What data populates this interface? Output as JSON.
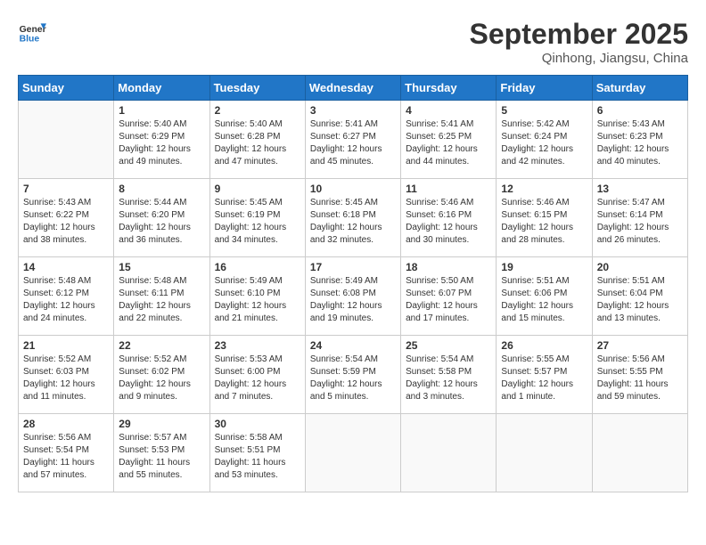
{
  "header": {
    "logo_line1": "General",
    "logo_line2": "Blue",
    "month": "September 2025",
    "location": "Qinhong, Jiangsu, China"
  },
  "days_of_week": [
    "Sunday",
    "Monday",
    "Tuesday",
    "Wednesday",
    "Thursday",
    "Friday",
    "Saturday"
  ],
  "weeks": [
    [
      {
        "day": "",
        "info": ""
      },
      {
        "day": "1",
        "info": "Sunrise: 5:40 AM\nSunset: 6:29 PM\nDaylight: 12 hours\nand 49 minutes."
      },
      {
        "day": "2",
        "info": "Sunrise: 5:40 AM\nSunset: 6:28 PM\nDaylight: 12 hours\nand 47 minutes."
      },
      {
        "day": "3",
        "info": "Sunrise: 5:41 AM\nSunset: 6:27 PM\nDaylight: 12 hours\nand 45 minutes."
      },
      {
        "day": "4",
        "info": "Sunrise: 5:41 AM\nSunset: 6:25 PM\nDaylight: 12 hours\nand 44 minutes."
      },
      {
        "day": "5",
        "info": "Sunrise: 5:42 AM\nSunset: 6:24 PM\nDaylight: 12 hours\nand 42 minutes."
      },
      {
        "day": "6",
        "info": "Sunrise: 5:43 AM\nSunset: 6:23 PM\nDaylight: 12 hours\nand 40 minutes."
      }
    ],
    [
      {
        "day": "7",
        "info": "Sunrise: 5:43 AM\nSunset: 6:22 PM\nDaylight: 12 hours\nand 38 minutes."
      },
      {
        "day": "8",
        "info": "Sunrise: 5:44 AM\nSunset: 6:20 PM\nDaylight: 12 hours\nand 36 minutes."
      },
      {
        "day": "9",
        "info": "Sunrise: 5:45 AM\nSunset: 6:19 PM\nDaylight: 12 hours\nand 34 minutes."
      },
      {
        "day": "10",
        "info": "Sunrise: 5:45 AM\nSunset: 6:18 PM\nDaylight: 12 hours\nand 32 minutes."
      },
      {
        "day": "11",
        "info": "Sunrise: 5:46 AM\nSunset: 6:16 PM\nDaylight: 12 hours\nand 30 minutes."
      },
      {
        "day": "12",
        "info": "Sunrise: 5:46 AM\nSunset: 6:15 PM\nDaylight: 12 hours\nand 28 minutes."
      },
      {
        "day": "13",
        "info": "Sunrise: 5:47 AM\nSunset: 6:14 PM\nDaylight: 12 hours\nand 26 minutes."
      }
    ],
    [
      {
        "day": "14",
        "info": "Sunrise: 5:48 AM\nSunset: 6:12 PM\nDaylight: 12 hours\nand 24 minutes."
      },
      {
        "day": "15",
        "info": "Sunrise: 5:48 AM\nSunset: 6:11 PM\nDaylight: 12 hours\nand 22 minutes."
      },
      {
        "day": "16",
        "info": "Sunrise: 5:49 AM\nSunset: 6:10 PM\nDaylight: 12 hours\nand 21 minutes."
      },
      {
        "day": "17",
        "info": "Sunrise: 5:49 AM\nSunset: 6:08 PM\nDaylight: 12 hours\nand 19 minutes."
      },
      {
        "day": "18",
        "info": "Sunrise: 5:50 AM\nSunset: 6:07 PM\nDaylight: 12 hours\nand 17 minutes."
      },
      {
        "day": "19",
        "info": "Sunrise: 5:51 AM\nSunset: 6:06 PM\nDaylight: 12 hours\nand 15 minutes."
      },
      {
        "day": "20",
        "info": "Sunrise: 5:51 AM\nSunset: 6:04 PM\nDaylight: 12 hours\nand 13 minutes."
      }
    ],
    [
      {
        "day": "21",
        "info": "Sunrise: 5:52 AM\nSunset: 6:03 PM\nDaylight: 12 hours\nand 11 minutes."
      },
      {
        "day": "22",
        "info": "Sunrise: 5:52 AM\nSunset: 6:02 PM\nDaylight: 12 hours\nand 9 minutes."
      },
      {
        "day": "23",
        "info": "Sunrise: 5:53 AM\nSunset: 6:00 PM\nDaylight: 12 hours\nand 7 minutes."
      },
      {
        "day": "24",
        "info": "Sunrise: 5:54 AM\nSunset: 5:59 PM\nDaylight: 12 hours\nand 5 minutes."
      },
      {
        "day": "25",
        "info": "Sunrise: 5:54 AM\nSunset: 5:58 PM\nDaylight: 12 hours\nand 3 minutes."
      },
      {
        "day": "26",
        "info": "Sunrise: 5:55 AM\nSunset: 5:57 PM\nDaylight: 12 hours\nand 1 minute."
      },
      {
        "day": "27",
        "info": "Sunrise: 5:56 AM\nSunset: 5:55 PM\nDaylight: 11 hours\nand 59 minutes."
      }
    ],
    [
      {
        "day": "28",
        "info": "Sunrise: 5:56 AM\nSunset: 5:54 PM\nDaylight: 11 hours\nand 57 minutes."
      },
      {
        "day": "29",
        "info": "Sunrise: 5:57 AM\nSunset: 5:53 PM\nDaylight: 11 hours\nand 55 minutes."
      },
      {
        "day": "30",
        "info": "Sunrise: 5:58 AM\nSunset: 5:51 PM\nDaylight: 11 hours\nand 53 minutes."
      },
      {
        "day": "",
        "info": ""
      },
      {
        "day": "",
        "info": ""
      },
      {
        "day": "",
        "info": ""
      },
      {
        "day": "",
        "info": ""
      }
    ]
  ]
}
